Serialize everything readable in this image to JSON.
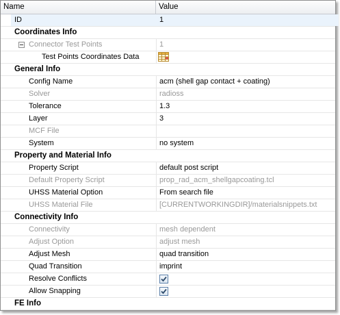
{
  "header": {
    "name_col": "Name",
    "value_col": "Value"
  },
  "id_row": {
    "label": "ID",
    "value": "1"
  },
  "sections": {
    "coordinates": "Coordinates Info",
    "general": "General Info",
    "property": "Property and Material Info",
    "connectivity": "Connectivity Info",
    "fe": "FE Info"
  },
  "coordinates": {
    "test_points": {
      "label": "Connector Test Points",
      "value": "1"
    },
    "coords_data": {
      "label": "Test Points Coordinates Data",
      "icon": "table-grid-icon"
    }
  },
  "general": {
    "config": {
      "label": "Config Name",
      "value": "acm (shell gap contact + coating)"
    },
    "solver": {
      "label": "Solver",
      "value": "radioss"
    },
    "tolerance": {
      "label": "Tolerance",
      "value": "1.3"
    },
    "layer": {
      "label": "Layer",
      "value": "3"
    },
    "mcf": {
      "label": "MCF File",
      "value": ""
    },
    "system": {
      "label": "System",
      "value": "no system"
    }
  },
  "property": {
    "script": {
      "label": "Property Script",
      "value": "default post script"
    },
    "default_script": {
      "label": "Default Property Script",
      "value": "prop_rad_acm_shellgapcoating.tcl"
    },
    "uhss_option": {
      "label": "UHSS Material Option",
      "value": "From search file"
    },
    "uhss_file": {
      "label": "UHSS Material File",
      "value": "[CURRENTWORKINGDIR]/materialsnippets.txt"
    }
  },
  "connectivity": {
    "connectivity": {
      "label": "Connectivity",
      "value": "mesh dependent"
    },
    "adjust_option": {
      "label": "Adjust Option",
      "value": "adjust mesh"
    },
    "adjust_mesh": {
      "label": "Adjust Mesh",
      "value": "quad transition"
    },
    "quad_transition": {
      "label": "Quad Transition",
      "value": "imprint"
    },
    "resolve": {
      "label": "Resolve Conflicts",
      "checked": true
    },
    "snapping": {
      "label": "Allow Snapping",
      "checked": true
    }
  },
  "colors": {
    "disabled_text": "#999999",
    "selected_row": "#eaf3fc",
    "checkbox_border": "#5a7ea8",
    "check_mark": "#2c4a6b"
  }
}
